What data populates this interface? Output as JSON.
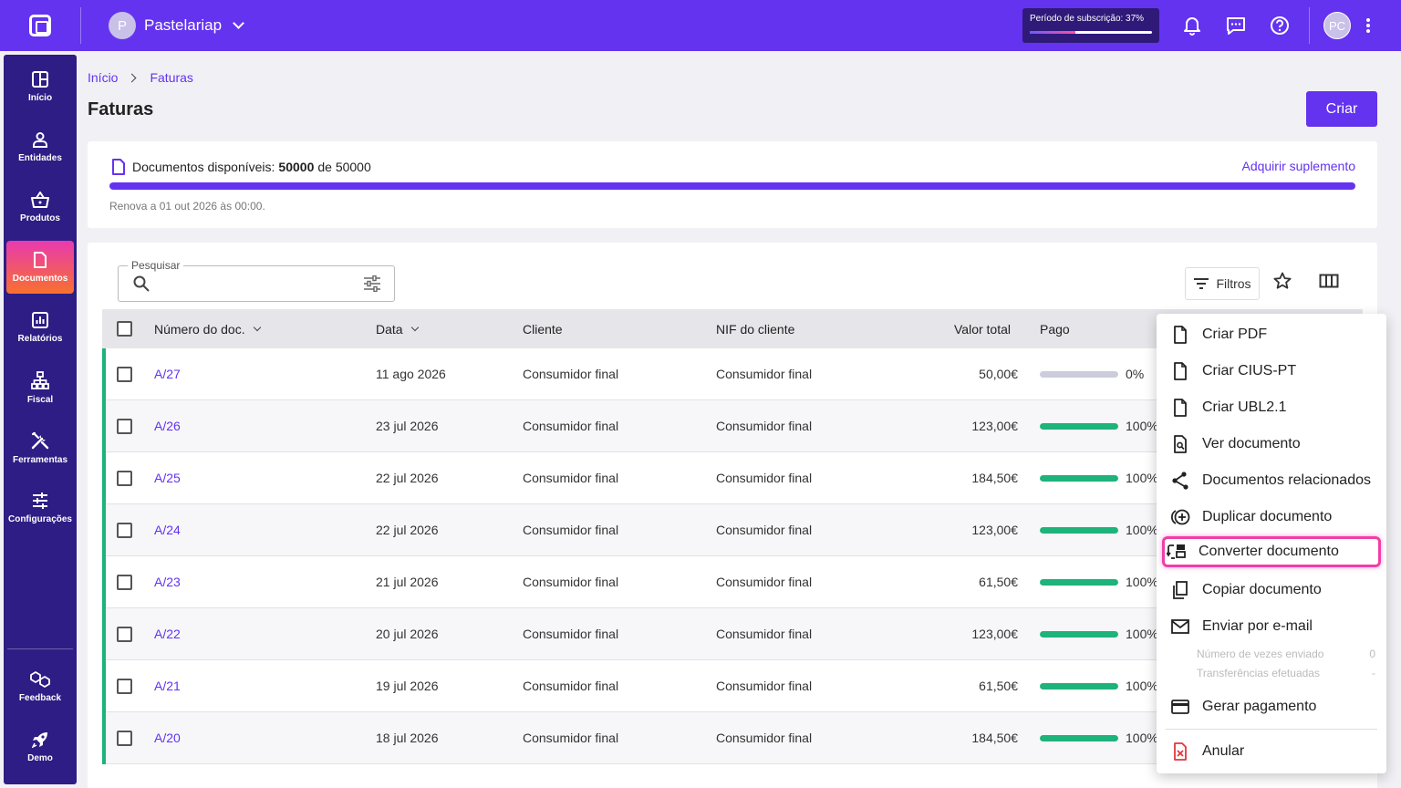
{
  "topbar": {
    "company_initial": "P",
    "company_name": "Pastelariap",
    "subscription_label": "Período de subscrição: 37%",
    "subscription_progress": 0.37,
    "user_initials": "PC"
  },
  "sidebar": {
    "items": [
      {
        "label": "Início",
        "icon": "grid-icon"
      },
      {
        "label": "Entidades",
        "icon": "person-icon"
      },
      {
        "label": "Produtos",
        "icon": "basket-icon"
      },
      {
        "label": "Documentos",
        "icon": "document-icon",
        "active": true
      },
      {
        "label": "Relatórios",
        "icon": "chart-icon"
      },
      {
        "label": "Fiscal",
        "icon": "hierarchy-icon"
      },
      {
        "label": "Ferramentas",
        "icon": "tools-icon"
      },
      {
        "label": "Configurações",
        "icon": "sliders-icon"
      }
    ],
    "bottom": [
      {
        "label": "Feedback",
        "icon": "feedback-icon"
      },
      {
        "label": "Demo",
        "icon": "rocket-icon"
      }
    ]
  },
  "breadcrumb": {
    "home": "Início",
    "current": "Faturas"
  },
  "page": {
    "title": "Faturas",
    "create_label": "Criar"
  },
  "documents": {
    "label": "Documentos disponíveis:",
    "available": "50000",
    "of": "de 50000",
    "link": "Adquirir suplemento",
    "renew": "Renova a 01 out 2026 às 00:00.",
    "fraction": 1.0
  },
  "toolbar": {
    "search_label": "Pesquisar",
    "filters_label": "Filtros"
  },
  "table": {
    "headers": {
      "number": "Número do doc.",
      "date": "Data",
      "client": "Cliente",
      "nif": "NIF do cliente",
      "total": "Valor total",
      "paid": "Pago"
    },
    "rows": [
      {
        "number": "A/27",
        "date": "11 ago 2026",
        "client": "Consumidor final",
        "nif": "Consumidor final",
        "total": "50,00€",
        "paid_pct": "0%",
        "paid": 0
      },
      {
        "number": "A/26",
        "date": "23 jul 2026",
        "client": "Consumidor final",
        "nif": "Consumidor final",
        "total": "123,00€",
        "paid_pct": "100%",
        "paid": 100
      },
      {
        "number": "A/25",
        "date": "22 jul 2026",
        "client": "Consumidor final",
        "nif": "Consumidor final",
        "total": "184,50€",
        "paid_pct": "100%",
        "paid": 100
      },
      {
        "number": "A/24",
        "date": "22 jul 2026",
        "client": "Consumidor final",
        "nif": "Consumidor final",
        "total": "123,00€",
        "paid_pct": "100%",
        "paid": 100
      },
      {
        "number": "A/23",
        "date": "21 jul 2026",
        "client": "Consumidor final",
        "nif": "Consumidor final",
        "total": "61,50€",
        "paid_pct": "100%",
        "paid": 100
      },
      {
        "number": "A/22",
        "date": "20 jul 2026",
        "client": "Consumidor final",
        "nif": "Consumidor final",
        "total": "123,00€",
        "paid_pct": "100%",
        "paid": 100
      },
      {
        "number": "A/21",
        "date": "19 jul 2026",
        "client": "Consumidor final",
        "nif": "Consumidor final",
        "total": "61,50€",
        "paid_pct": "100%",
        "paid": 100
      },
      {
        "number": "A/20",
        "date": "18 jul 2026",
        "client": "Consumidor final",
        "nif": "Consumidor final",
        "total": "184,50€",
        "paid_pct": "100%",
        "paid": 100
      }
    ]
  },
  "menu": {
    "items": [
      {
        "label": "Criar PDF",
        "icon": "file-icon"
      },
      {
        "label": "Criar CIUS-PT",
        "icon": "file-icon"
      },
      {
        "label": "Criar UBL2.1",
        "icon": "file-icon"
      },
      {
        "label": "Ver documento",
        "icon": "file-search-icon"
      },
      {
        "label": "Documentos relacionados",
        "icon": "share-nodes-icon"
      },
      {
        "label": "Duplicar documento",
        "icon": "duplicate-icon"
      },
      {
        "label": "Converter documento",
        "icon": "convert-icon",
        "highlighted": true
      },
      {
        "label": "Copiar documento",
        "icon": "copy-icon"
      },
      {
        "label": "Enviar por e-mail",
        "icon": "mail-icon"
      },
      {
        "label": "Gerar pagamento",
        "icon": "credit-card-icon"
      },
      {
        "label": "Anular",
        "icon": "cancel-file-icon"
      }
    ],
    "email_meta": [
      {
        "label": "Número de vezes enviado",
        "value": "0"
      },
      {
        "label": "Transferências efetuadas",
        "value": "-"
      }
    ]
  },
  "colors": {
    "brand": "#6433f0",
    "sidebar": "#2d1d84",
    "success": "#1db37a",
    "highlight": "#f03ea8",
    "danger": "#e0383e"
  }
}
